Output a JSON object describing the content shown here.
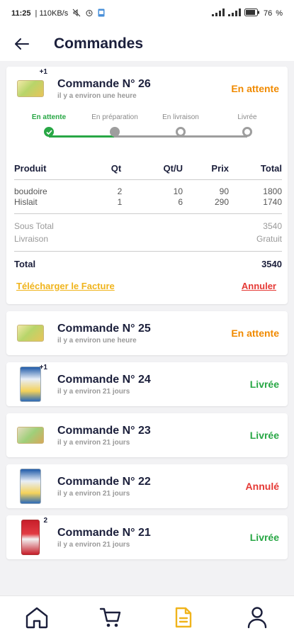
{
  "status_bar": {
    "time": "11:25",
    "speed": "110KB/s",
    "battery": "76"
  },
  "header": {
    "title": "Commandes"
  },
  "colors": {
    "pending": "#f08a00",
    "delivered": "#28a745",
    "cancelled": "#e53935",
    "accent": "#f0b41c"
  },
  "expanded_order": {
    "title": "Commande N° 26",
    "time": "il y a environ une heure",
    "status": "En attente",
    "badge": "+1",
    "steps": [
      "En attente",
      "En préparation",
      "En livraison",
      "Livrée"
    ],
    "progress_step": 1,
    "table_headers": [
      "Produit",
      "Qt",
      "Qt/U",
      "Prix",
      "Total"
    ],
    "items": [
      {
        "product": "boudoire",
        "qt": "2",
        "qtu": "10",
        "prix": "90",
        "total": "1800"
      },
      {
        "product": "Hislait",
        "qt": "1",
        "qtu": "6",
        "prix": "290",
        "total": "1740"
      }
    ],
    "subtotal_label": "Sous Total",
    "subtotal_value": "3540",
    "delivery_label": "Livraison",
    "delivery_value": "Gratuit",
    "total_label": "Total",
    "total_value": "3540",
    "download_label": "Télécharger le Facture",
    "cancel_label": "Annuler"
  },
  "orders": [
    {
      "title": "Commande N° 25",
      "time": "il y a environ une heure",
      "status": "En attente",
      "status_color": "#f08a00",
      "icon": "product-box",
      "badge": ""
    },
    {
      "title": "Commande N° 24",
      "time": "il y a environ 21 jours",
      "status": "Livrée",
      "status_color": "#28a745",
      "icon": "milk-carton",
      "badge": "+1"
    },
    {
      "title": "Commande N° 23",
      "time": "il y a environ 21 jours",
      "status": "Livrée",
      "status_color": "#28a745",
      "icon": "product-box",
      "badge": ""
    },
    {
      "title": "Commande N° 22",
      "time": "il y a environ 21 jours",
      "status": "Annulé",
      "status_color": "#e53935",
      "icon": "milk-carton",
      "badge": ""
    },
    {
      "title": "Commande N° 21",
      "time": "il y a environ 21 jours",
      "status": "Livrée",
      "status_color": "#28a745",
      "icon": "red-package",
      "badge": "2"
    }
  ],
  "bottom_nav": [
    "home-icon",
    "cart-icon",
    "orders-icon",
    "profile-icon"
  ]
}
